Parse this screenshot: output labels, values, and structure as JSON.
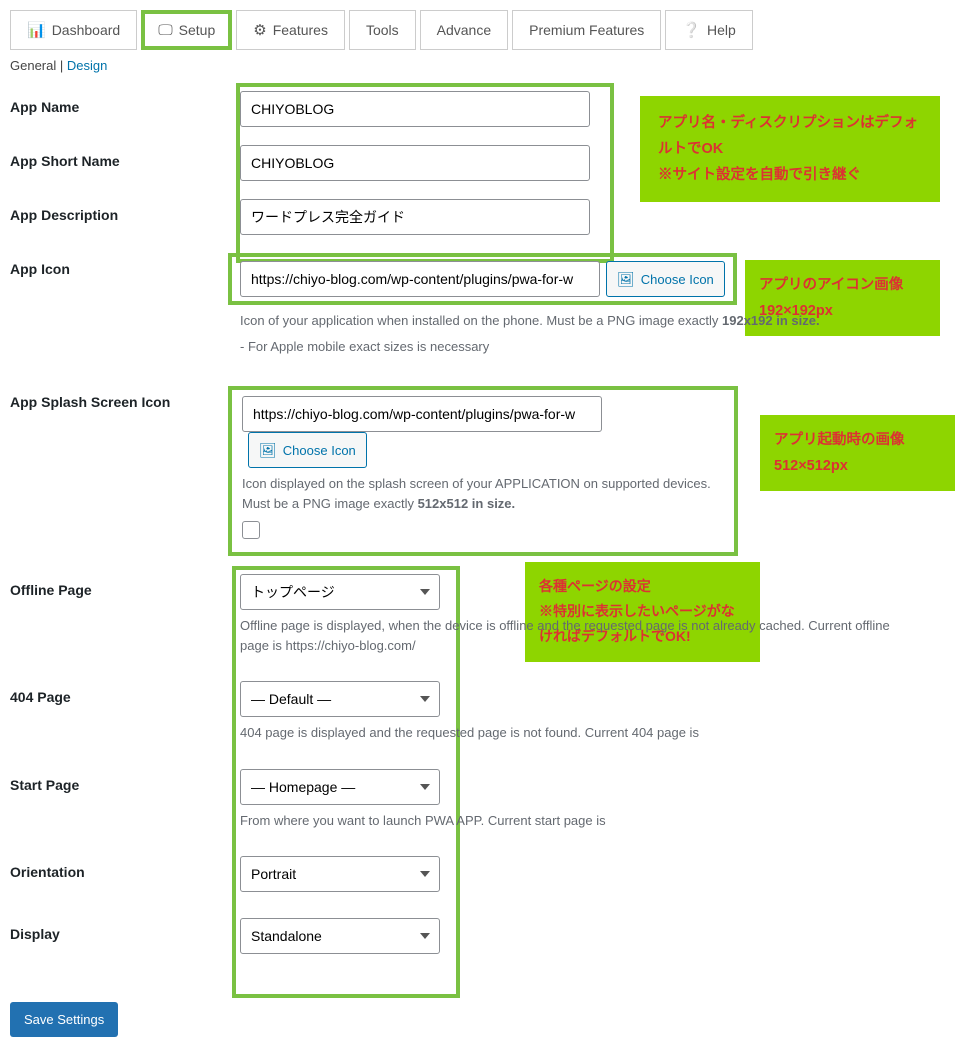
{
  "tabs": {
    "dashboard": "Dashboard",
    "setup": "Setup",
    "features": "Features",
    "tools": "Tools",
    "advance": "Advance",
    "premium": "Premium Features",
    "help": "Help"
  },
  "subtabs": {
    "general": "General",
    "design": "Design",
    "sep": " | "
  },
  "fields": {
    "app_name": {
      "label": "App Name",
      "value": "CHIYOBLOG"
    },
    "app_short": {
      "label": "App Short Name",
      "value": "CHIYOBLOG"
    },
    "app_desc": {
      "label": "App Description",
      "value": "ワードプレス完全ガイド"
    },
    "app_icon": {
      "label": "App Icon",
      "value": "https://chiyo-blog.com/wp-content/plugins/pwa-for-w",
      "button": "Choose Icon",
      "help1": "Icon of your application when installed on the phone. Must be a PNG image exactly ",
      "help1b": "192x192 in size.",
      "help2": "- For Apple mobile exact sizes is necessary"
    },
    "splash": {
      "label": "App Splash Screen Icon",
      "value": "https://chiyo-blog.com/wp-content/plugins/pwa-for-w",
      "button": "Choose Icon",
      "help1": "Icon displayed on the splash screen of your APPLICATION on supported devices. Must be a PNG image exactly ",
      "help1b": "512x512 in size."
    },
    "offline": {
      "label": "Offline Page",
      "value": "トップページ",
      "help": "Offline page is displayed, when the device is offline and the requested page is not already cached. Current offline page is https://chiyo-blog.com/"
    },
    "p404": {
      "label": "404 Page",
      "value": "— Default —",
      "help": "404 page is displayed and the requested page is not found. Current 404 page is"
    },
    "start": {
      "label": "Start Page",
      "value": "— Homepage —",
      "help": "From where you want to launch PWA APP. Current start page is"
    },
    "orientation": {
      "label": "Orientation",
      "value": "Portrait"
    },
    "display": {
      "label": "Display",
      "value": "Standalone"
    }
  },
  "callouts": {
    "c1a": "アプリ名・ディスクリプションはデフォルトでOK",
    "c1b": "※サイト設定を自動で引き継ぐ",
    "c2a": "アプリのアイコン画像",
    "c2b": "192×192px",
    "c3a": "アプリ起動時の画像",
    "c3b": "512×512px",
    "c4a": "各種ページの設定",
    "c4b": "※特別に表示したいページがなければデフォルトでOK!"
  },
  "save": "Save Settings"
}
